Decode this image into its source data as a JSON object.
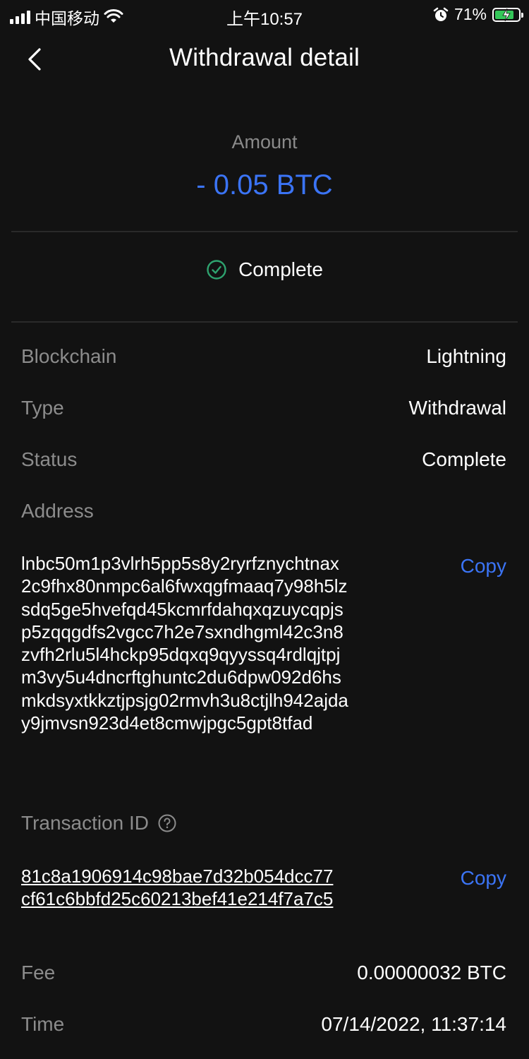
{
  "status_bar": {
    "carrier": "中国移动",
    "time": "上午10:57",
    "battery_pct": "71%"
  },
  "nav": {
    "title": "Withdrawal detail"
  },
  "amount": {
    "label": "Amount",
    "value": "- 0.05 BTC"
  },
  "status_banner": {
    "label": "Complete"
  },
  "details": {
    "blockchain": {
      "label": "Blockchain",
      "value": "Lightning"
    },
    "type": {
      "label": "Type",
      "value": "Withdrawal"
    },
    "status": {
      "label": "Status",
      "value": "Complete"
    },
    "address": {
      "label": "Address",
      "value": "lnbc50m1p3vlrh5pp5s8y2ryrfznychtnax2c9fhx80nmpc6al6fwxqgfmaaq7y98h5lzsdq5ge5hvefqd45kcmrfdahqxqzuycqpjsp5zqqgdfs2vgcc7h2e7sxndhgml42c3n8zvfh2rlu5l4hckp95dqxq9qyyssq4rdlqjtpjm3vy5u4dncrftghuntc2du6dpw092d6hsmkdsyxtkkztjpsjg02rmvh3u8ctjlh942ajday9jmvsn923d4et8cmwjpgc5gpt8tfad",
      "copy_label": "Copy"
    },
    "transaction_id": {
      "label": "Transaction ID",
      "value": "81c8a1906914c98bae7d32b054dcc77cf61c6bbfd25c60213bef41e214f7a7c5",
      "copy_label": "Copy"
    },
    "fee": {
      "label": "Fee",
      "value": "0.00000032 BTC"
    },
    "time": {
      "label": "Time",
      "value": "07/14/2022, 11:37:14"
    }
  },
  "colors": {
    "background": "#121212",
    "accent": "#3b74f5",
    "success": "#2ea36f",
    "muted": "#8c8c8c"
  }
}
